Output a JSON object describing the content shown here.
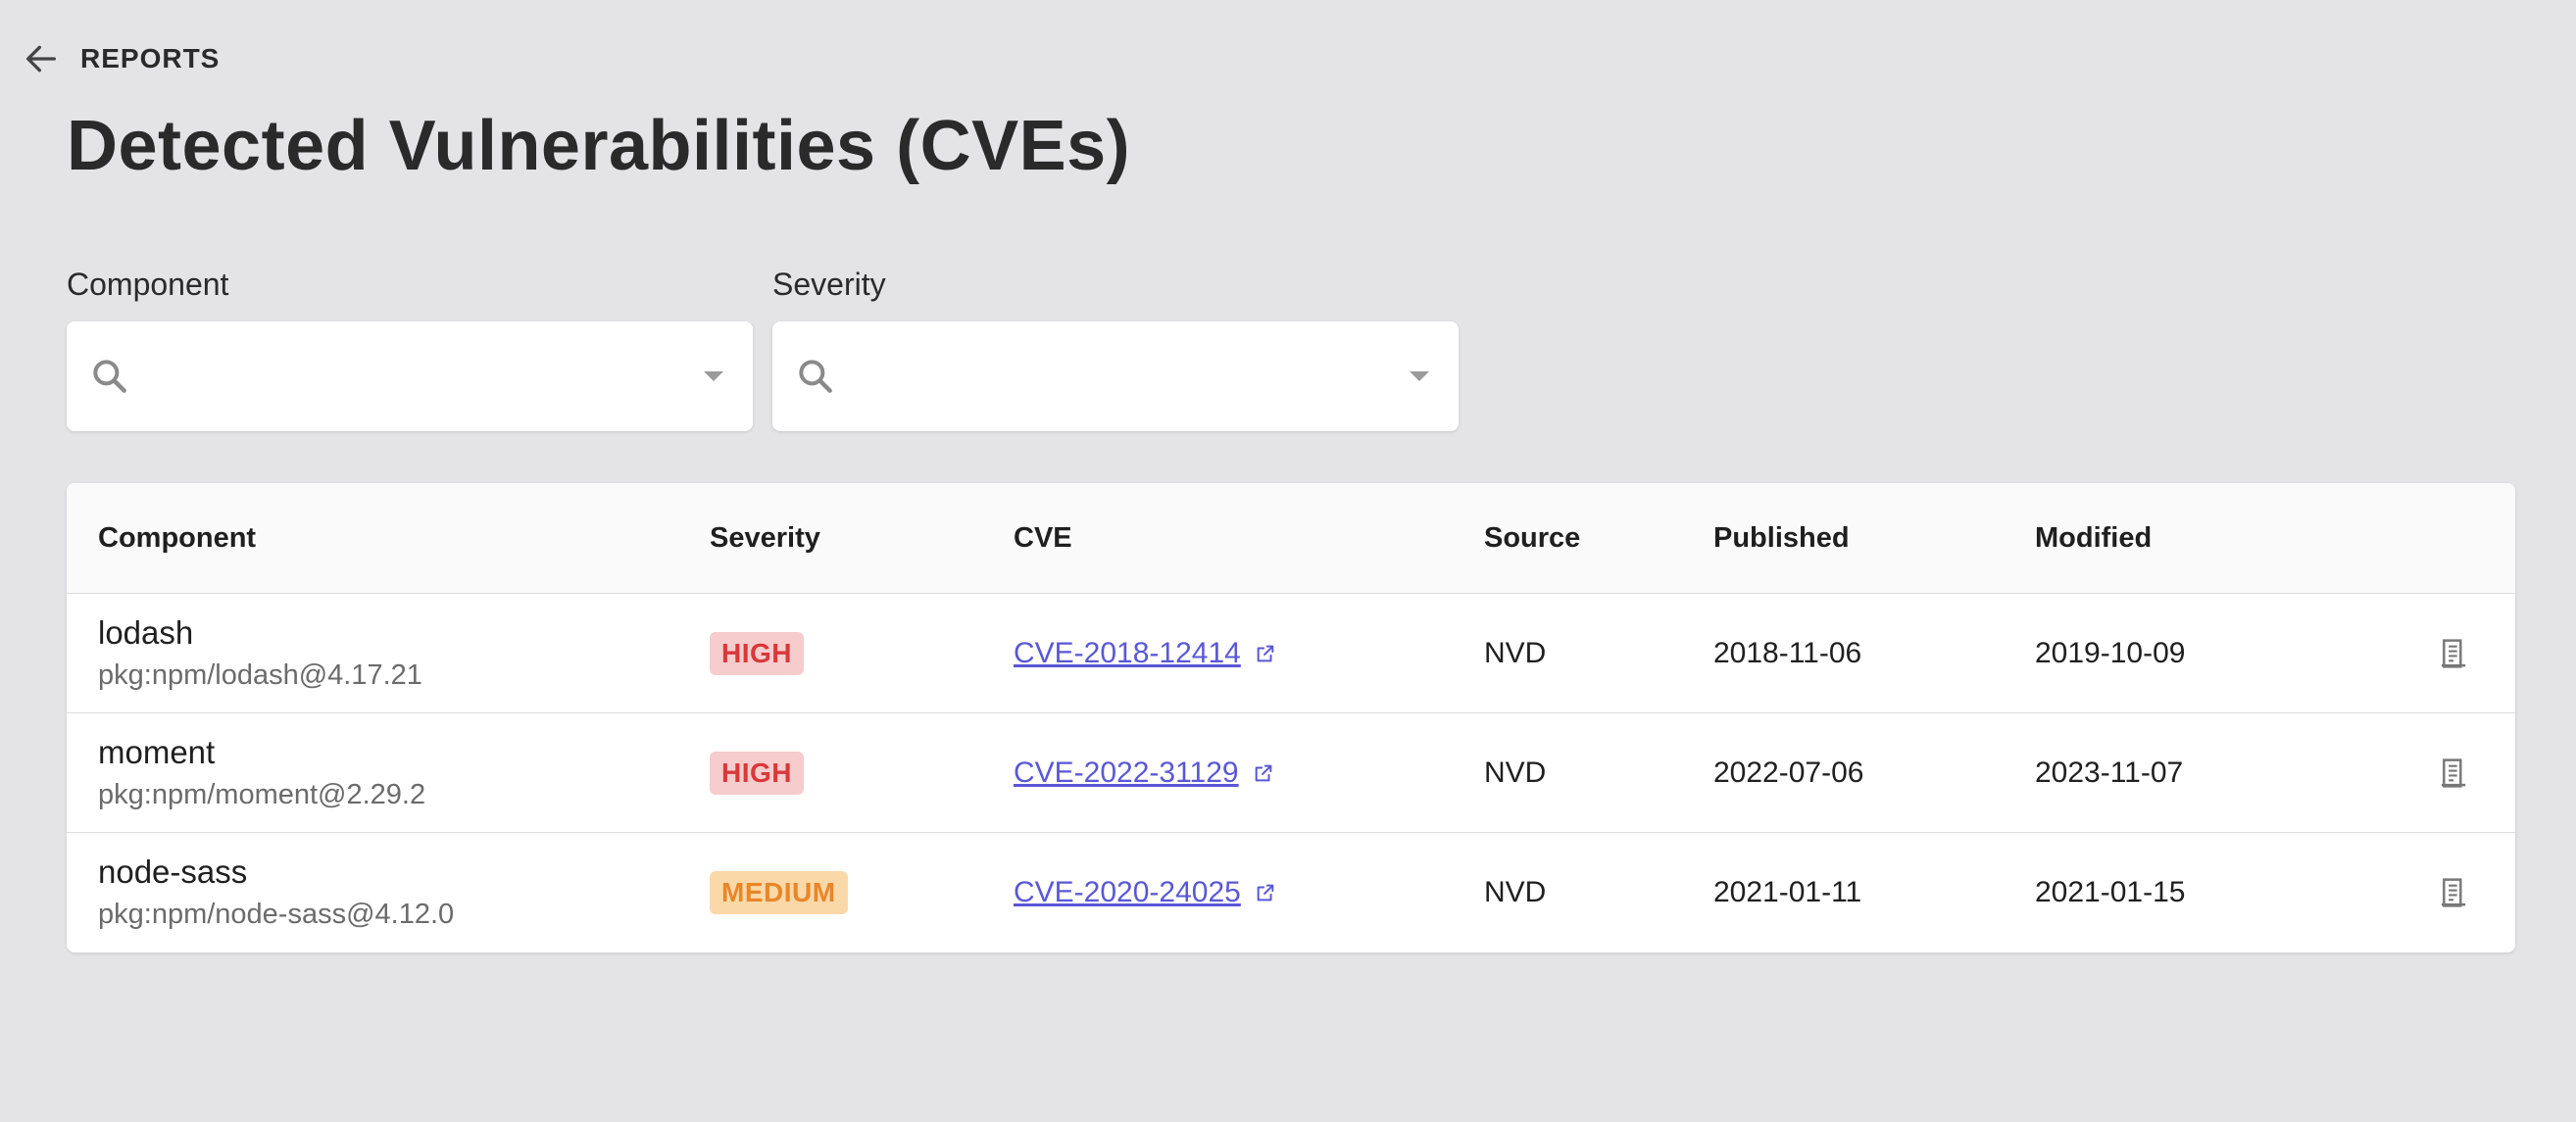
{
  "nav": {
    "back_label": "REPORTS"
  },
  "page": {
    "title": "Detected Vulnerabilities (CVEs)"
  },
  "filters": [
    {
      "label": "Component",
      "value": "",
      "placeholder": ""
    },
    {
      "label": "Severity",
      "value": "",
      "placeholder": ""
    }
  ],
  "table": {
    "headers": [
      "Component",
      "Severity",
      "CVE",
      "Source",
      "Published",
      "Modified"
    ],
    "rows": [
      {
        "name": "lodash",
        "purl": "pkg:npm/lodash@4.17.21",
        "severity": "HIGH",
        "cve": "CVE-2018-12414",
        "source": "NVD",
        "published": "2018-11-06",
        "modified": "2019-10-09"
      },
      {
        "name": "moment",
        "purl": "pkg:npm/moment@2.29.2",
        "severity": "HIGH",
        "cve": "CVE-2022-31129",
        "source": "NVD",
        "published": "2022-07-06",
        "modified": "2023-11-07"
      },
      {
        "name": "node-sass",
        "purl": "pkg:npm/node-sass@4.12.0",
        "severity": "MEDIUM",
        "cve": "CVE-2020-24025",
        "source": "NVD",
        "published": "2021-01-11",
        "modified": "2021-01-15"
      }
    ]
  },
  "colors": {
    "high_bg": "#f6cccc",
    "high_fg": "#d9383a",
    "medium_bg": "#fbd8a8",
    "medium_fg": "#e8862a",
    "link": "#5a57d6"
  }
}
